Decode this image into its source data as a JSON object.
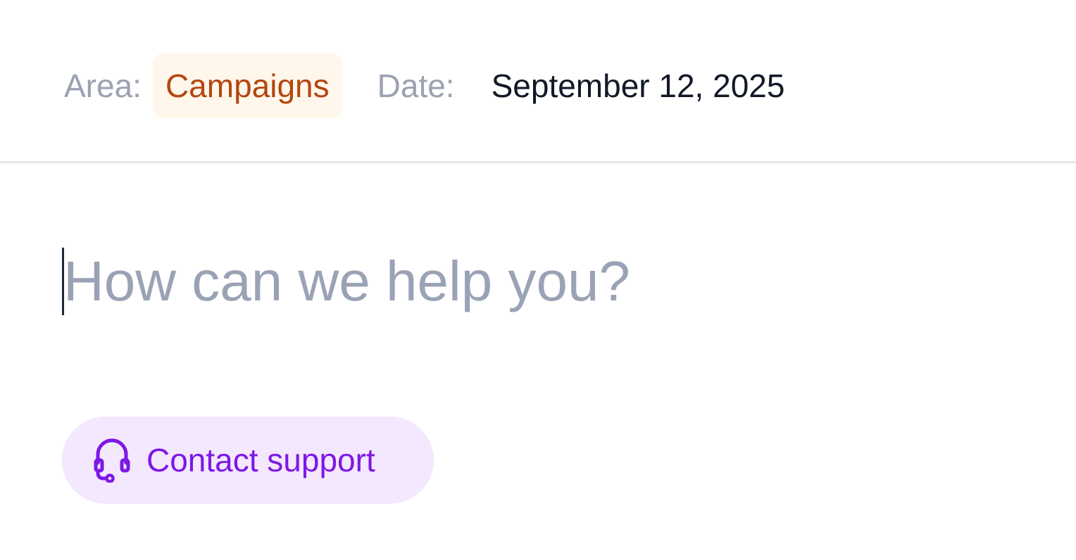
{
  "header": {
    "area_label": "Area:",
    "area_value": "Campaigns",
    "date_label": "Date:",
    "date_value": "September 12, 2025"
  },
  "composer": {
    "placeholder": "How can we help you?",
    "value": ""
  },
  "support_button": {
    "label": "Contact support",
    "icon": "headset-icon"
  },
  "colors": {
    "area_chip_bg": "#fff7eb",
    "area_chip_text": "#b4460f",
    "support_bg": "#f3e8fd",
    "support_accent": "#7e17e6",
    "muted_text": "#9aa2b1"
  }
}
